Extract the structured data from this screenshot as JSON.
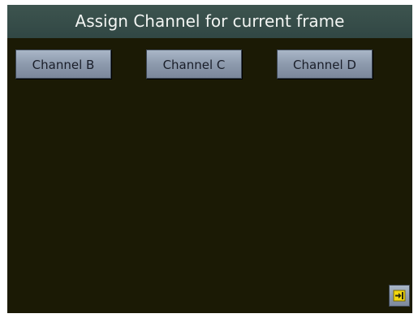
{
  "title": "Assign Channel for current frame",
  "channels": [
    {
      "label": "Channel B"
    },
    {
      "label": "Channel C"
    },
    {
      "label": "Channel D"
    }
  ],
  "exit_button": {
    "icon": "exit-icon"
  },
  "colors": {
    "background": "#1b1a05",
    "title_bar": "#35504b",
    "button": "#8d9aad",
    "exit_icon": "#f4d80e"
  }
}
